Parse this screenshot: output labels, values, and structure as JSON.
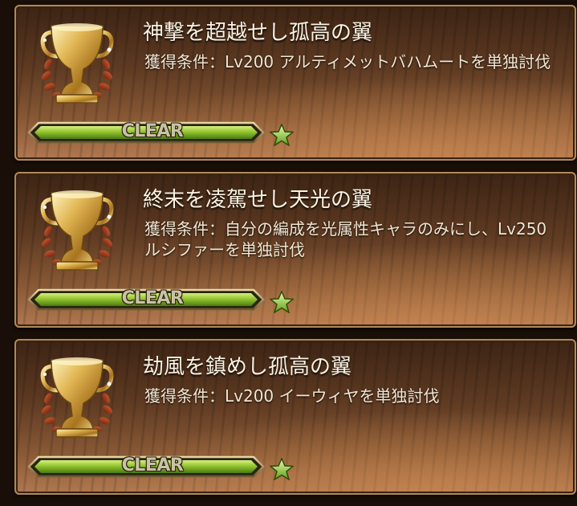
{
  "achievements": [
    {
      "title": "神撃を超越せし孤高の翼",
      "condition_label": "獲得条件：",
      "condition_text": "Lv200 アルティメットバハムートを単独討伐",
      "status": "CLEAR",
      "progress": 1.0,
      "icon": "trophy-icon",
      "badge_icon": "star-icon"
    },
    {
      "title": "終末を凌駕せし天光の翼",
      "condition_label": "獲得条件：",
      "condition_text": "自分の編成を光属性キャラのみにし、Lv250 ルシファーを単独討伐",
      "status": "CLEAR",
      "progress": 1.0,
      "icon": "trophy-icon",
      "badge_icon": "star-icon"
    },
    {
      "title": "劫風を鎮めし孤高の翼",
      "condition_label": "獲得条件：",
      "condition_text": "Lv200 イーウィヤを単独討伐",
      "status": "CLEAR",
      "progress": 1.0,
      "icon": "trophy-icon",
      "badge_icon": "star-icon"
    }
  ],
  "colors": {
    "gauge_fill": "#8cbf2a",
    "star": "#9fd23a",
    "frame": "#b08a58"
  }
}
